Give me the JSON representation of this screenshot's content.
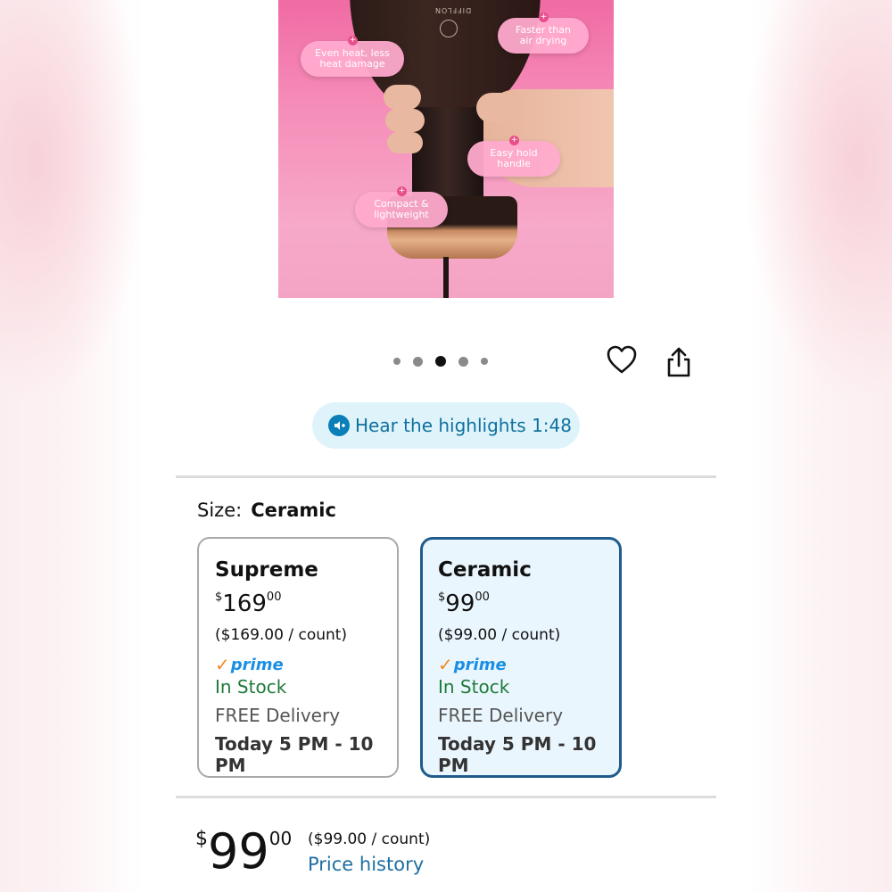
{
  "product_image": {
    "brand": "DIFFLON",
    "callouts": [
      {
        "id": "faster",
        "label": "Faster than air drying"
      },
      {
        "id": "even_heat",
        "label": "Even heat, less heat damage"
      },
      {
        "id": "easy_hold",
        "label": "Easy hold handle"
      },
      {
        "id": "compact",
        "label": "Compact & lightweight"
      }
    ]
  },
  "carousel": {
    "total": 5,
    "active_index": 2
  },
  "actions": {
    "favorite_icon": "heart-icon",
    "share_icon": "share-icon"
  },
  "highlights": {
    "label": "Hear the highlights 1:48",
    "icon": "speaker-icon"
  },
  "size": {
    "label": "Size:",
    "selected": "Ceramic"
  },
  "options": [
    {
      "name": "Supreme",
      "price": {
        "currency": "$",
        "whole": "169",
        "cents": "00"
      },
      "unit_price": "($169.00 / count)",
      "prime": "prime",
      "stock": "In Stock",
      "delivery": "FREE Delivery",
      "window": "Today 5 PM - 10 PM",
      "selected": false
    },
    {
      "name": "Ceramic",
      "price": {
        "currency": "$",
        "whole": "99",
        "cents": "00"
      },
      "unit_price": "($99.00 / count)",
      "prime": "prime",
      "stock": "In Stock",
      "delivery": "FREE Delivery",
      "window": "Today 5 PM - 10 PM",
      "selected": true
    }
  ],
  "price": {
    "currency": "$",
    "whole": "99",
    "cents": "00",
    "unit_price": "($99.00 / count)",
    "history_link": "Price history"
  },
  "colors": {
    "accent_blue": "#1f5b8c",
    "link_blue": "#1e6fa3",
    "in_stock_green": "#1f7a3a",
    "prime_blue": "#1a8fe3",
    "prime_check": "#f08a24"
  }
}
